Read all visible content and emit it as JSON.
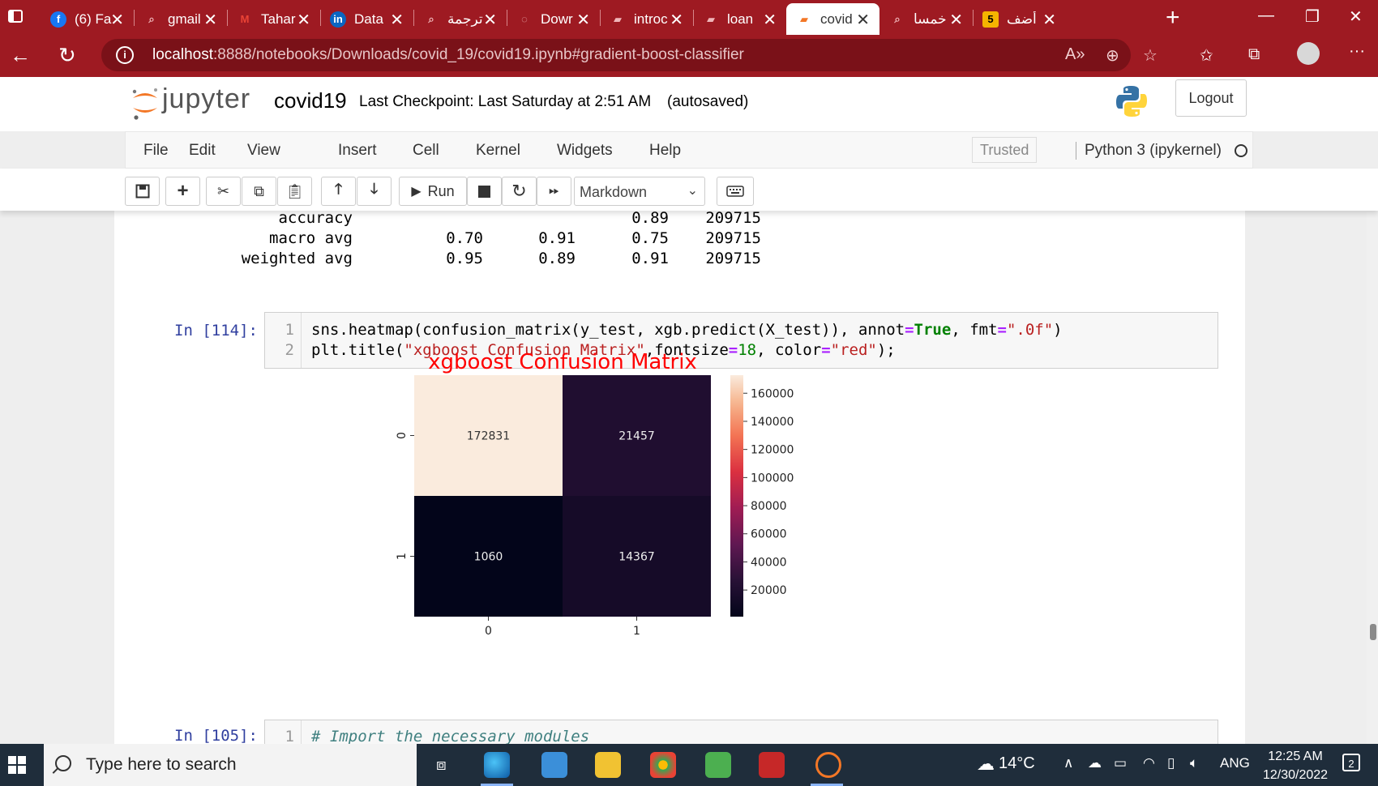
{
  "browser": {
    "tabs": [
      {
        "label": "(6) Fa",
        "favicon": "facebook-icon",
        "color": "#1877f2",
        "glyph": "f"
      },
      {
        "label": "gmail",
        "favicon": "search-icon",
        "color": "#9e1a22",
        "glyph": "⌕"
      },
      {
        "label": "Tahar",
        "favicon": "gmail-icon",
        "color": "#ffffff",
        "glyph": "M"
      },
      {
        "label": "Data",
        "favicon": "linkedin-icon",
        "color": "#0a66c2",
        "glyph": "in"
      },
      {
        "label": "ترجمة",
        "favicon": "search-icon",
        "color": "#9e1a22",
        "glyph": "⌕"
      },
      {
        "label": "Dowr",
        "favicon": "jupyter-icon",
        "color": "#9e1a22",
        "glyph": "◌"
      },
      {
        "label": "introc",
        "favicon": "notebook-icon",
        "color": "#9e1a22",
        "glyph": "▰"
      },
      {
        "label": "loan",
        "favicon": "notebook-icon",
        "color": "#9e1a22",
        "glyph": "▰"
      },
      {
        "label": "covid",
        "favicon": "notebook-icon",
        "color": "#ffffff",
        "glyph": "▰"
      },
      {
        "label": "خمسا",
        "favicon": "search-icon",
        "color": "#9e1a22",
        "glyph": "⌕"
      },
      {
        "label": "أضف",
        "favicon": "five-icon",
        "color": "#f5b400",
        "glyph": "5"
      }
    ],
    "url_host": "localhost",
    "url_path": ":8888/notebooks/Downloads/covid_19/covid19.ipynb#gradient-boost-classifier"
  },
  "jupyter": {
    "logo_text": "jupyter",
    "notebook_name": "covid19",
    "checkpoint": "Last Checkpoint: Last Saturday at 2:51 AM",
    "autosave": "(autosaved)",
    "logout": "Logout",
    "menu": [
      "File",
      "Edit",
      "View",
      "Insert",
      "Cell",
      "Kernel",
      "Widgets",
      "Help"
    ],
    "trusted": "Trusted",
    "kernel": "Python 3 (ipykernel)",
    "toolbar": {
      "run": "Run",
      "cell_type": "Markdown"
    }
  },
  "report_rows": [
    {
      "label": "accuracy",
      "precision": "",
      "recall": "",
      "f1": "0.89",
      "support": "209715"
    },
    {
      "label": "macro avg",
      "precision": "0.70",
      "recall": "0.91",
      "f1": "0.75",
      "support": "209715"
    },
    {
      "label": "weighted avg",
      "precision": "0.95",
      "recall": "0.89",
      "f1": "0.91",
      "support": "209715"
    }
  ],
  "cells": {
    "cell114": {
      "prompt": "In [114]:",
      "line_numbers": [
        "1",
        "2"
      ],
      "line1": {
        "a": "sns.heatmap(confusion_matrix(y_test, xgb.predict(X_test)), annot",
        "b": "=",
        "c": "True",
        "d": ", fmt",
        "e": "=",
        "f": "\".0f\"",
        "g": ")"
      },
      "line2": {
        "a": "plt.title(",
        "b": "\"xgboost Confusion Matrix\"",
        "c": ",fontsize",
        "d": "=",
        "e": "18",
        "f": ", color",
        "g": "=",
        "h": "\"red\"",
        "i": ");"
      }
    },
    "cell105": {
      "prompt": "In [105]:",
      "line_number": "1",
      "comment": "# Import the necessary modules"
    }
  },
  "chart_data": {
    "type": "heatmap",
    "title": "xgboost Confusion Matrix",
    "title_color": "#ff0000",
    "x_categories": [
      "0",
      "1"
    ],
    "y_categories": [
      "0",
      "1"
    ],
    "values": [
      [
        172831,
        21457
      ],
      [
        1060,
        14367
      ]
    ],
    "colorbar_ticks": [
      160000,
      140000,
      120000,
      100000,
      80000,
      60000,
      40000,
      20000
    ],
    "colorbar_range": [
      1060,
      172831
    ],
    "colormap": "rocket"
  },
  "taskbar": {
    "search_placeholder": "Type here to search",
    "temperature": "14°C",
    "language": "ANG",
    "time": "12:25 AM",
    "date": "12/30/2022",
    "notifications": "2"
  }
}
